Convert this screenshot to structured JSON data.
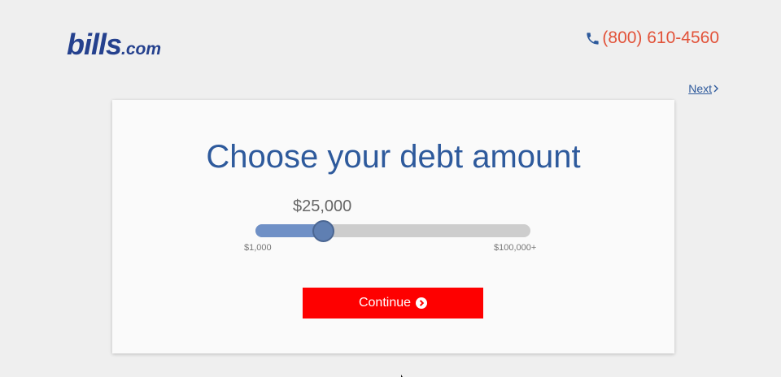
{
  "header": {
    "logo_main": "bills",
    "logo_tld": ".com",
    "phone": "(800) 610-4560",
    "next_label": "Next"
  },
  "card": {
    "title": "Choose your debt amount",
    "amount": "$25,000",
    "slider": {
      "min_label": "$1,000",
      "max_label": "$100,000+",
      "level_percent": 24.5
    },
    "continue_label": "Continue"
  },
  "colors": {
    "brand": "#25418e",
    "phone": "#e2533a",
    "title": "#2e5a9c",
    "button": "#fe0000",
    "slider_fill": "#6f90c6"
  },
  "icons": {
    "phone": "phone-icon",
    "next": "chevron-right-icon",
    "continue": "circle-chevron-right-icon"
  }
}
